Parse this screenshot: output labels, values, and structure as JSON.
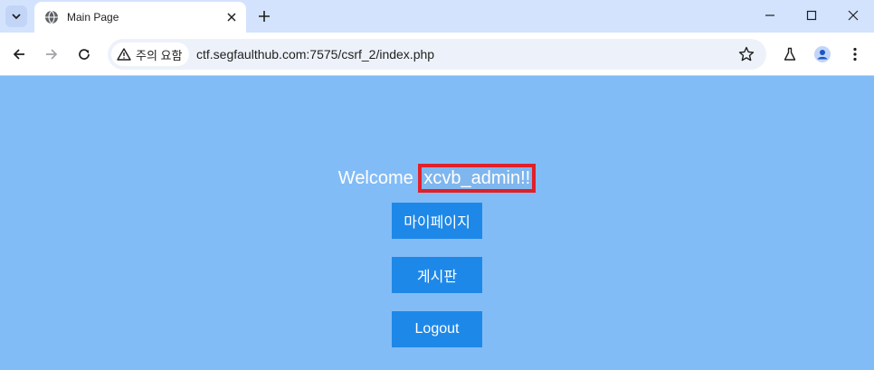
{
  "browser": {
    "tab": {
      "title": "Main Page"
    },
    "omnibox": {
      "security_label": "주의 요함",
      "url": "ctf.segfaulthub.com:7575/csrf_2/index.php"
    },
    "icons": [
      "tab-search-icon",
      "globe-icon",
      "close-icon",
      "plus-icon",
      "minimize-icon",
      "maximize-icon",
      "close-window-icon",
      "back-arrow-icon",
      "forward-arrow-icon",
      "reload-icon",
      "warning-icon",
      "star-icon",
      "labs-flask-icon",
      "profile-icon",
      "more-vert-icon"
    ]
  },
  "page": {
    "welcome_prefix": "Welcome",
    "username": "xcvb_admin!!",
    "buttons": {
      "mypage": "마이페이지",
      "board": "게시판",
      "logout": "Logout"
    },
    "colors": {
      "background": "#82bcf6",
      "button": "#1e88e8",
      "highlight_border": "#e0202a"
    }
  }
}
